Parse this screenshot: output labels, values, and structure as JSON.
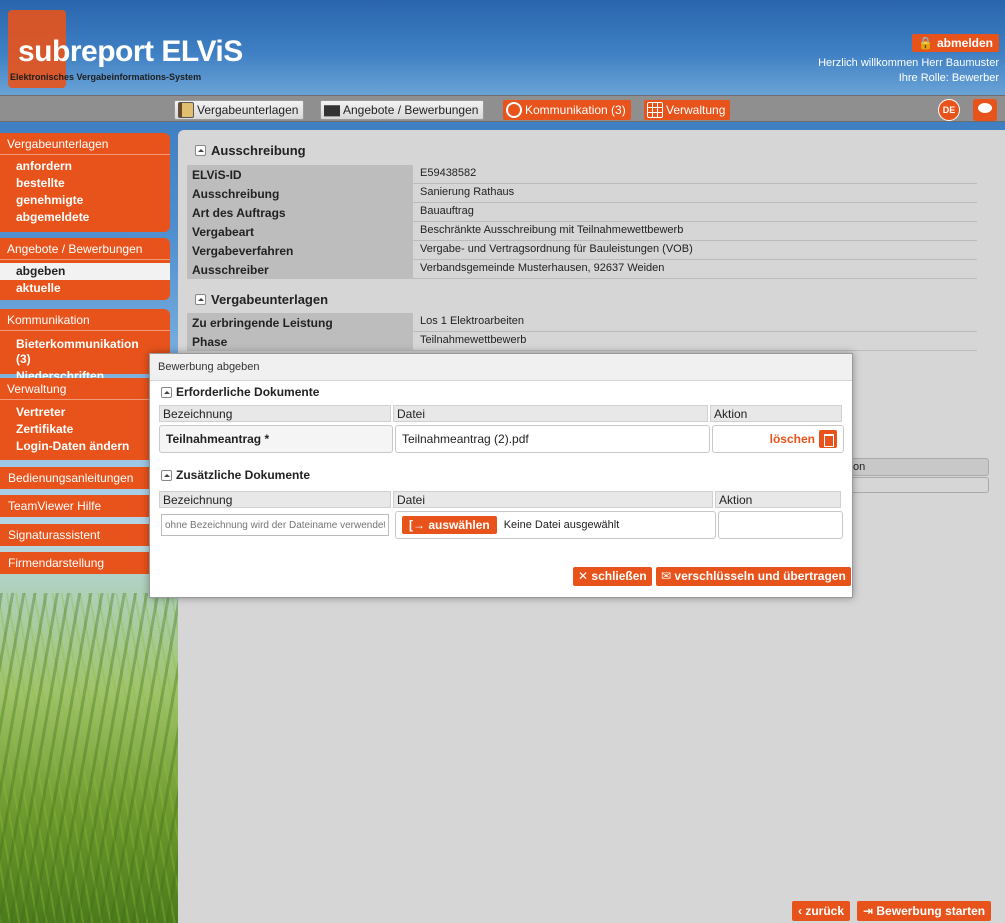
{
  "header": {
    "logo_sub": "sub",
    "logo_rest": "report ELViS",
    "tagline": "Elektronisches Vergabeinformations-System",
    "logout_label": "abmelden",
    "welcome": "Herzlich willkommen Herr Baumuster",
    "role": "Ihre Rolle: Bewerber"
  },
  "topnav": {
    "vergabeunterlagen": "Vergabeunterlagen",
    "angebote": "Angebote / Bewerbungen",
    "kommunikation": "Kommunikation (3)",
    "verwaltung": "Verwaltung",
    "lang": "DE"
  },
  "sidebar": {
    "vergabe": {
      "title": "Vergabeunterlagen",
      "items": [
        "anfordern",
        "bestellte",
        "genehmigte",
        "abgemeldete"
      ]
    },
    "angebote": {
      "title": "Angebote / Bewerbungen",
      "items": [
        "abgeben",
        "aktuelle"
      ]
    },
    "kommunikation": {
      "title": "Kommunikation",
      "items": [
        "Bieterkommunikation (3)",
        "Niederschriften"
      ]
    },
    "verwaltung": {
      "title": "Verwaltung",
      "items": [
        "Vertreter",
        "Zertifikate",
        "Login-Daten ändern"
      ]
    },
    "buttons": [
      "Bedienungsanleitungen",
      "TeamViewer Hilfe",
      "Signaturassistent",
      "Firmendarstellung"
    ]
  },
  "main": {
    "ausschreibung_title": "Ausschreibung",
    "rows": [
      {
        "k": "ELViS-ID",
        "v": "E59438582"
      },
      {
        "k": "Ausschreibung",
        "v": "Sanierung Rathaus"
      },
      {
        "k": "Art des Auftrags",
        "v": "Bauauftrag"
      },
      {
        "k": "Vergabeart",
        "v": "Beschränkte Ausschreibung mit Teilnahmewettbewerb"
      },
      {
        "k": "Vergabeverfahren",
        "v": "Vergabe- und Vertragsordnung für Bauleistungen (VOB)"
      },
      {
        "k": "Ausschreiber",
        "v": "Verbandsgemeinde Musterhausen, 92637 Weiden"
      }
    ],
    "vergabeunterlagen_title": "Vergabeunterlagen",
    "rows2": [
      {
        "k": "Zu erbringende Leistung",
        "v": "Los 1 Elektroarbeiten"
      },
      {
        "k": "Phase",
        "v": "Teilnahmewettbewerb"
      }
    ],
    "partial_on": "on"
  },
  "bottom": {
    "back": "zurück",
    "start": "Bewerbung starten"
  },
  "modal": {
    "title": "Bewerbung abgeben",
    "required_title": "Erforderliche Dokumente",
    "col_name": "Bezeichnung",
    "col_file": "Datei",
    "col_action": "Aktion",
    "req_row": {
      "name": "Teilnahmeantrag *",
      "file": "Teilnahmeantrag (2).pdf",
      "action": "löschen"
    },
    "extra_title": "Zusätzliche Dokumente",
    "extra_row": {
      "placeholder": "ohne Bezeichnung wird der Dateiname verwendet",
      "pick": "auswählen",
      "nofile": "Keine Datei ausgewählt"
    },
    "close": "schließen",
    "submit": "verschlüsseln und übertragen"
  },
  "colors": {
    "accent": "#e8531b",
    "panel": "#d6d6d6"
  }
}
